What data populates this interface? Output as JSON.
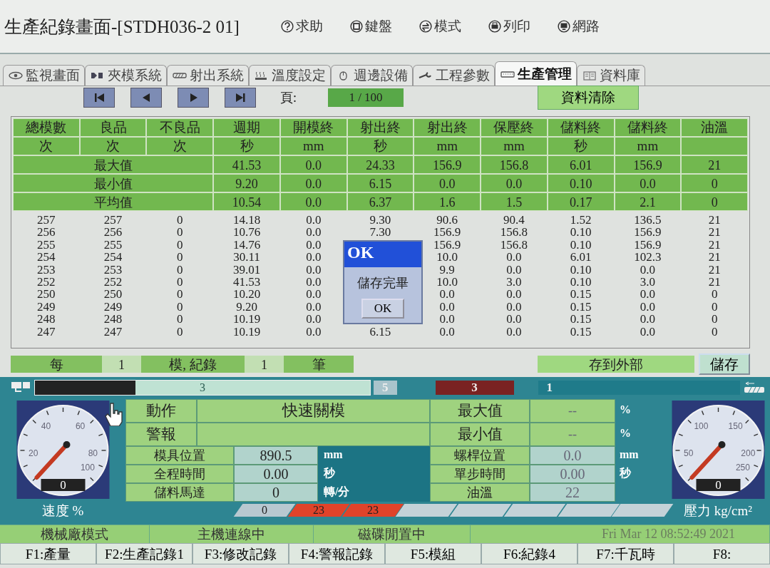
{
  "header": {
    "title": "生產紀錄畫面-[STDH036-2 01]",
    "menu": [
      {
        "label": "求助"
      },
      {
        "label": "鍵盤"
      },
      {
        "label": "模式"
      },
      {
        "label": "列印"
      },
      {
        "label": "網路"
      }
    ]
  },
  "tabs": [
    {
      "label": "監視畫面",
      "selected": false
    },
    {
      "label": "夾模系統",
      "selected": false
    },
    {
      "label": "射出系統",
      "selected": false
    },
    {
      "label": "溫度設定",
      "selected": false
    },
    {
      "label": "週邊設備",
      "selected": false
    },
    {
      "label": "工程參數",
      "selected": false
    },
    {
      "label": "生產管理",
      "selected": true
    },
    {
      "label": "資料庫",
      "selected": false
    }
  ],
  "pager": {
    "label": "頁:",
    "page": "1  / 100",
    "clear": "資料清除"
  },
  "table": {
    "columns": [
      {
        "name": "總模數",
        "unit": "次"
      },
      {
        "name": "良品",
        "unit": "次"
      },
      {
        "name": "不良品",
        "unit": "次"
      },
      {
        "name": "週期",
        "unit": "秒"
      },
      {
        "name": "開模終",
        "unit": "mm"
      },
      {
        "name": "射出終",
        "unit": "秒"
      },
      {
        "name": "射出終",
        "unit": "mm"
      },
      {
        "name": "保壓終",
        "unit": "mm"
      },
      {
        "name": "儲料終",
        "unit": "秒"
      },
      {
        "name": "儲料終",
        "unit": "mm"
      },
      {
        "name": "油溫"
      }
    ],
    "summary": [
      {
        "label": "最大值",
        "values": [
          "41.53",
          "0.0",
          "24.33",
          "156.9",
          "156.8",
          "6.01",
          "156.9",
          "21"
        ]
      },
      {
        "label": "最小值",
        "values": [
          "9.20",
          "0.0",
          "6.15",
          "0.0",
          "0.0",
          "0.10",
          "0.0",
          "0"
        ]
      },
      {
        "label": "平均值",
        "values": [
          "10.54",
          "0.0",
          "6.37",
          "1.6",
          "1.5",
          "0.17",
          "2.1",
          "0"
        ]
      }
    ],
    "rows": [
      [
        "257",
        "257",
        "0",
        "14.18",
        "0.0",
        "9.30",
        "90.6",
        "90.4",
        "1.52",
        "136.5",
        "21"
      ],
      [
        "256",
        "256",
        "0",
        "10.76",
        "0.0",
        "7.30",
        "156.9",
        "156.8",
        "0.10",
        "156.9",
        "21"
      ],
      [
        "255",
        "255",
        "0",
        "14.76",
        "0.0",
        null,
        "156.9",
        "156.8",
        "0.10",
        "156.9",
        "21"
      ],
      [
        "254",
        "254",
        "0",
        "30.11",
        "0.0",
        null,
        "10.0",
        "0.0",
        "6.01",
        "102.3",
        "21"
      ],
      [
        "253",
        "253",
        "0",
        "39.01",
        "0.0",
        null,
        "9.9",
        "0.0",
        "0.10",
        "0.0",
        "21"
      ],
      [
        "252",
        "252",
        "0",
        "41.53",
        "0.0",
        null,
        "10.0",
        "3.0",
        "0.10",
        "3.0",
        "21"
      ],
      [
        "250",
        "250",
        "0",
        "10.20",
        "0.0",
        null,
        "0.0",
        "0.0",
        "0.15",
        "0.0",
        "0"
      ],
      [
        "249",
        "249",
        "0",
        "9.20",
        "0.0",
        null,
        "0.0",
        "0.0",
        "0.15",
        "0.0",
        "0"
      ],
      [
        "248",
        "248",
        "0",
        "10.19",
        "0.0",
        null,
        "0.0",
        "0.0",
        "0.15",
        "0.0",
        "0"
      ],
      [
        "247",
        "247",
        "0",
        "10.19",
        "0.0",
        "6.15",
        "0.0",
        "0.0",
        "0.15",
        "0.0",
        "0"
      ]
    ]
  },
  "dialog": {
    "title": "OK",
    "message": "儲存完畢",
    "button": "OK"
  },
  "record": {
    "every": "每",
    "count": "1",
    "unit": "模, 紀錄",
    "records": "1",
    "suffix": "筆",
    "export": "存到外部",
    "save": "儲存"
  },
  "progress": {
    "level": 0.3,
    "value": "3"
  },
  "stages": [
    {
      "value": "5",
      "color": "#a9c4cc"
    },
    {
      "value": "3",
      "color": "#7a2222"
    },
    {
      "value": "1",
      "color": "#1f7b8a"
    }
  ],
  "speed_gauge": {
    "ticks": [
      "20",
      "40",
      "60",
      "80",
      "100"
    ],
    "reading": "0",
    "label": "速度",
    "unit": "%"
  },
  "pressure_gauge": {
    "ticks": [
      "50",
      "100",
      "150",
      "200",
      "250"
    ],
    "reading": "0",
    "label": "壓力",
    "unit": "kg/cm²"
  },
  "status": [
    {
      "label": "動作",
      "value": "快速關模"
    },
    {
      "label": "警報"
    }
  ],
  "params": [
    {
      "label": "模具位置",
      "value": "890.5",
      "unit": "mm"
    },
    {
      "label": "全程時間",
      "value": "0.00",
      "unit": "秒"
    },
    {
      "label": "儲料馬達",
      "value": "0",
      "unit": "轉/分"
    }
  ],
  "limits": [
    {
      "label": "最大值",
      "value": "--",
      "unit": "%"
    },
    {
      "label": "最小值",
      "value": "--",
      "unit": "%"
    },
    {
      "label": "螺桿位置",
      "value": "0.0",
      "unit": "mm"
    },
    {
      "label": "單步時間",
      "value": "0.00",
      "unit": "秒"
    },
    {
      "label": "油溫",
      "value": "22"
    }
  ],
  "segments": [
    {
      "value": "0",
      "color": "#b8c8d0"
    },
    {
      "value": "23",
      "color": "#e0432a"
    },
    {
      "value": "23",
      "color": "#e0432a"
    },
    {
      "color": "#c4d2d8"
    },
    {
      "color": "#c4d2d8"
    },
    {
      "color": "#c4d2d8"
    },
    {
      "color": "#c4d2d8"
    },
    {
      "color": "#c4d2d8"
    }
  ],
  "status_bar": [
    "機械廠模式",
    "主機連線中",
    "磁碟閒置中",
    "Fri Mar 12 08:52:49 2021"
  ],
  "function_keys": [
    "F1:產量",
    "F2:生產記錄1",
    "F3:修改記錄",
    "F4:警報記錄",
    "F5:模組",
    "F6:紀錄4",
    "F7:千瓦時",
    "F8:"
  ]
}
